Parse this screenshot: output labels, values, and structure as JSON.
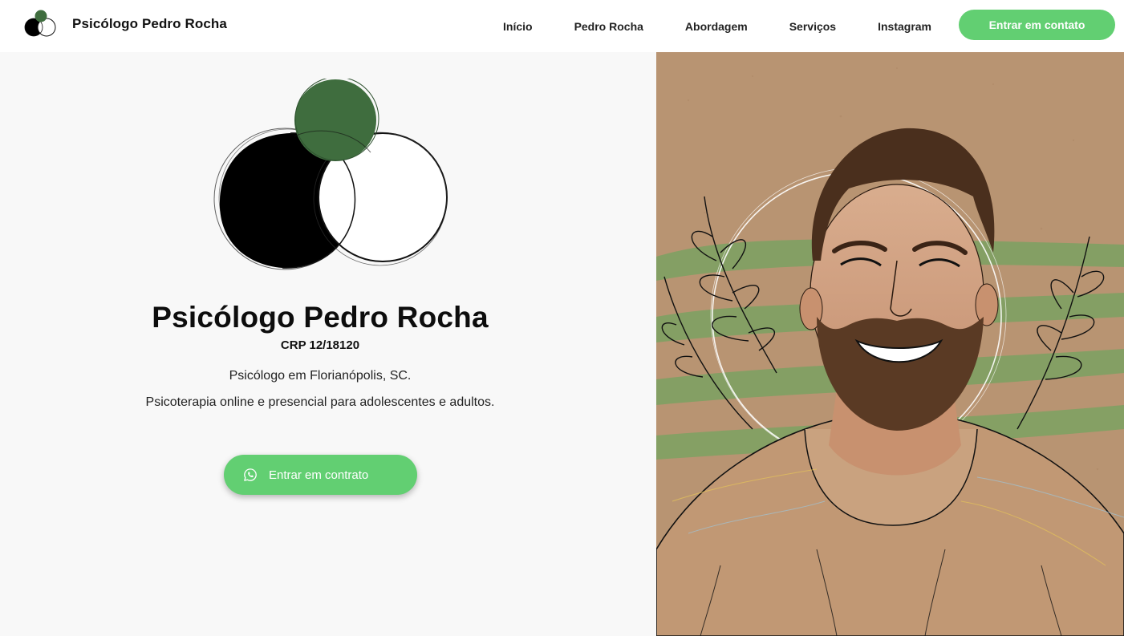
{
  "nav": {
    "brand_name": "Psicólogo Pedro Rocha",
    "links": [
      "Início",
      "Pedro Rocha",
      "Abordagem",
      "Serviços",
      "Instagram"
    ],
    "cta_label": "Entrar em contato"
  },
  "hero": {
    "title": "Psicólogo Pedro Rocha",
    "crp": "CRP 12/18120",
    "line1": "Psicólogo em Florianópolis, SC.",
    "line2": "Psicoterapia online e presencial para adolescentes e adultos.",
    "cta_label": "Entrar em contrato",
    "cta_icon": "whatsapp-icon"
  },
  "portrait": {
    "subject": "illustrated-portrait"
  },
  "colors": {
    "accent_green": "#62cf72",
    "logo_dark_green": "#3f6d3e",
    "portrait_bg": "#b89472",
    "leaf_green": "#7fa163",
    "page_bg": "#f8f8f8"
  }
}
